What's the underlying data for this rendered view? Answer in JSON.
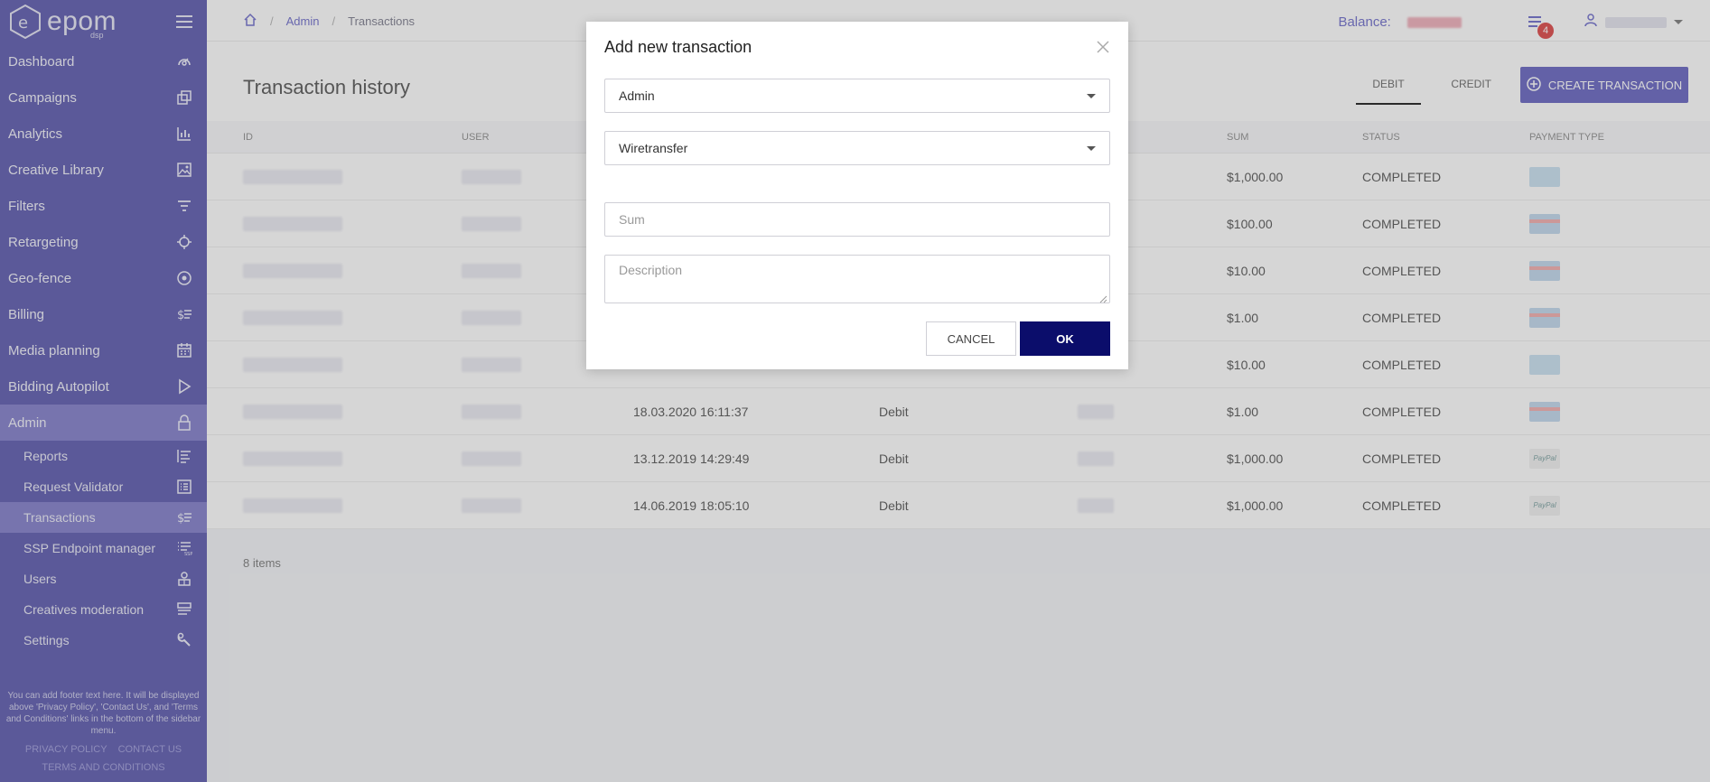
{
  "app": {
    "logo_text": "epom",
    "logo_sub": "dsp"
  },
  "sidebar": {
    "items": [
      {
        "label": "Dashboard",
        "icon": "gauge-icon"
      },
      {
        "label": "Campaigns",
        "icon": "copy-icon"
      },
      {
        "label": "Analytics",
        "icon": "bar-chart-icon"
      },
      {
        "label": "Creative Library",
        "icon": "image-icon"
      },
      {
        "label": "Filters",
        "icon": "filter-icon"
      },
      {
        "label": "Retargeting",
        "icon": "crosshair-icon"
      },
      {
        "label": "Geo-fence",
        "icon": "location-icon"
      },
      {
        "label": "Billing",
        "icon": "dollar-list-icon"
      },
      {
        "label": "Media planning",
        "icon": "calendar-icon"
      },
      {
        "label": "Bidding Autopilot",
        "icon": "play-icon"
      },
      {
        "label": "Admin",
        "icon": "lock-icon"
      }
    ],
    "sub_items": [
      {
        "label": "Reports",
        "icon": "report-icon"
      },
      {
        "label": "Request Validator",
        "icon": "list-check-icon"
      },
      {
        "label": "Transactions",
        "icon": "dollar-list-icon"
      },
      {
        "label": "SSP Endpoint manager",
        "icon": "ssp-icon"
      },
      {
        "label": "Users",
        "icon": "users-icon"
      },
      {
        "label": "Creatives moderation",
        "icon": "moderation-icon"
      },
      {
        "label": "Settings",
        "icon": "wrench-icon"
      }
    ],
    "footer_text": "You can add footer text here. It will be displayed above 'Privacy Policy', 'Contact Us', and 'Terms and Conditions' links in the bottom of the sidebar menu.",
    "links": {
      "privacy": "PRIVACY POLICY",
      "contact": "CONTACT US",
      "terms": "TERMS AND CONDITIONS"
    }
  },
  "topbar": {
    "breadcrumb": [
      "Admin",
      "Transactions"
    ],
    "balance_label": "Balance:",
    "notification_count": "4"
  },
  "page": {
    "title": "Transaction history",
    "tabs": {
      "debit": "DEBIT",
      "credit": "CREDIT"
    },
    "create_button": "CREATE TRANSACTION",
    "items_count": "8 items"
  },
  "table": {
    "headers": [
      "ID",
      "USER",
      "",
      "",
      "",
      "SUM",
      "STATUS",
      "PAYMENT TYPE"
    ],
    "rows": [
      {
        "date": "",
        "type": "",
        "sum": "$1,000.00",
        "status": "COMPLETED",
        "pay": "bank"
      },
      {
        "date": "",
        "type": "",
        "sum": "$100.00",
        "status": "COMPLETED",
        "pay": "card"
      },
      {
        "date": "",
        "type": "",
        "sum": "$10.00",
        "status": "COMPLETED",
        "pay": "card"
      },
      {
        "date": "",
        "type": "",
        "sum": "$1.00",
        "status": "COMPLETED",
        "pay": "card"
      },
      {
        "date": "",
        "type": "",
        "sum": "$10.00",
        "status": "COMPLETED",
        "pay": "bank"
      },
      {
        "date": "18.03.2020 16:11:37",
        "type": "Debit",
        "sum": "$1.00",
        "status": "COMPLETED",
        "pay": "card"
      },
      {
        "date": "13.12.2019 14:29:49",
        "type": "Debit",
        "sum": "$1,000.00",
        "status": "COMPLETED",
        "pay": "paypal"
      },
      {
        "date": "14.06.2019 18:05:10",
        "type": "Debit",
        "sum": "$1,000.00",
        "status": "COMPLETED",
        "pay": "paypal"
      }
    ]
  },
  "modal": {
    "title": "Add new transaction",
    "user_select": "Admin",
    "payment_select": "Wiretransfer",
    "sum_placeholder": "Sum",
    "description_placeholder": "Description",
    "cancel": "CANCEL",
    "ok": "OK"
  },
  "colors": {
    "sidebar": "#6d6ab7",
    "accent": "#7674c8",
    "ok_button": "#0b0d6b"
  }
}
